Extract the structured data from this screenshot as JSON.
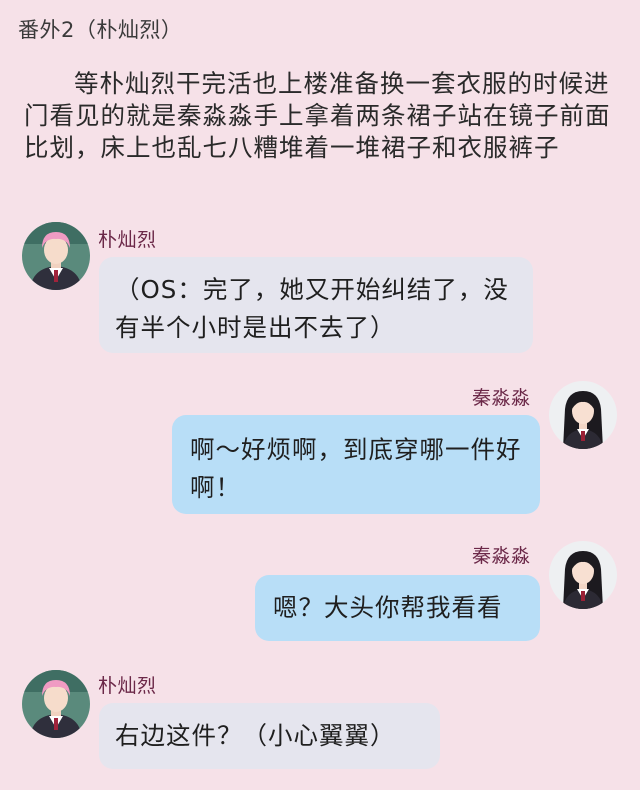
{
  "header": {
    "title": "番外2（朴灿烈）"
  },
  "narration": "等朴灿烈干完活也上楼准备换一套衣服的时候进门看见的就是秦淼淼手上拿着两条裙子站在镜子前面比划，床上也乱七八糟堆着一堆裙子和衣服裤子",
  "messages": [
    {
      "sender": "朴灿烈",
      "side": "left",
      "text": "（OS：完了，她又开始纠结了，没有半个小时是出不去了）"
    },
    {
      "sender": "秦淼淼",
      "side": "right",
      "text": "啊～好烦啊，到底穿哪一件好啊！"
    },
    {
      "sender": "秦淼淼",
      "side": "right",
      "text": "嗯？大头你帮我看看"
    },
    {
      "sender": "朴灿烈",
      "side": "left",
      "text": "右边这件？（小心翼翼）"
    }
  ],
  "colors": {
    "background": "#f6e1e8",
    "name_text": "#6b2848",
    "left_bubble": "#e5e5ee",
    "right_bubble": "#b8def7"
  }
}
